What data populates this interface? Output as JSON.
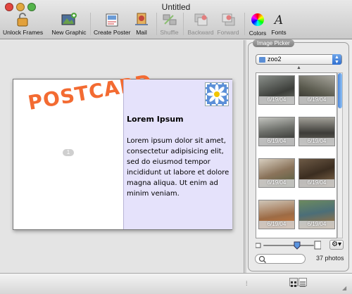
{
  "window": {
    "title": "Untitled"
  },
  "toolbar": {
    "unlock_frames": "Unlock Frames",
    "new_graphic": "New Graphic",
    "create_poster": "Create Poster",
    "mail": "Mail",
    "shuffle": "Shuffle",
    "backward": "Backward",
    "forward": "Forward",
    "colors": "Colors",
    "fonts": "Fonts"
  },
  "postcard": {
    "title": "POSTCARD",
    "badge": "1",
    "heading": "Lorem Ipsum",
    "body": "Lorem ipsum dolor sit amet, consectetur adipisicing elit, sed do eiusmod tempor incididunt ut labore et dolore magna aliqua. Ut enim ad minim veniam."
  },
  "image_picker": {
    "label": "Image Picker",
    "album": "zoo2",
    "photos": [
      {
        "date": "6/19/04"
      },
      {
        "date": "6/19/04"
      },
      {
        "date": "6/19/04"
      },
      {
        "date": "6/19/04"
      },
      {
        "date": "6/19/04"
      },
      {
        "date": "6/19/04"
      },
      {
        "date": "6/19/04"
      },
      {
        "date": "6/19/04"
      }
    ],
    "count": "37 photos"
  },
  "colors": {
    "accent": "#f36b32",
    "card_right": "#e5e2fb",
    "selection": "#3d80df"
  }
}
